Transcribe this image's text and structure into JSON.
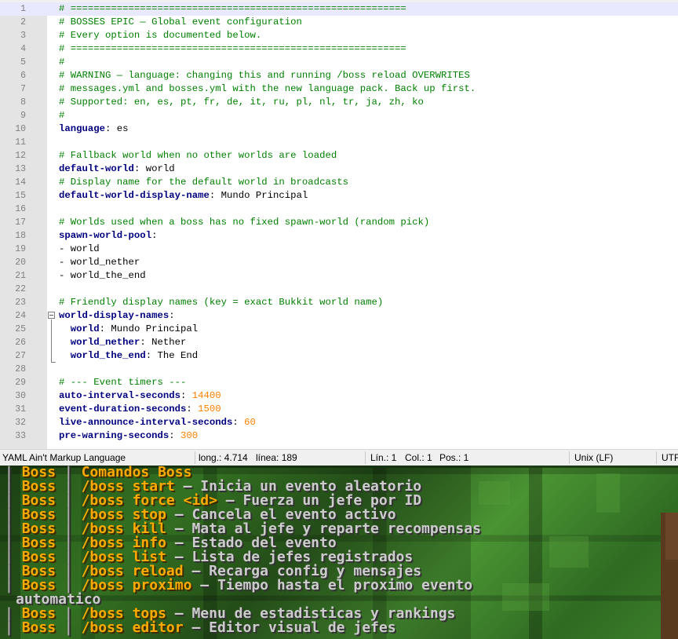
{
  "editor": {
    "current_line": 1,
    "fold_line": 24,
    "lines": [
      {
        "n": "1",
        "segs": [
          {
            "t": "# ==========================================================",
            "c": "cm"
          }
        ]
      },
      {
        "n": "2",
        "segs": [
          {
            "t": "# BOSSES EPIC — Global event configuration",
            "c": "cm"
          }
        ]
      },
      {
        "n": "3",
        "segs": [
          {
            "t": "# Every option is documented below.",
            "c": "cm"
          }
        ]
      },
      {
        "n": "4",
        "segs": [
          {
            "t": "# ==========================================================",
            "c": "cm"
          }
        ]
      },
      {
        "n": "5",
        "segs": [
          {
            "t": "#",
            "c": "cm"
          }
        ]
      },
      {
        "n": "6",
        "segs": [
          {
            "t": "# WARNING — language: changing this and running /boss reload OVERWRITES",
            "c": "cm"
          }
        ]
      },
      {
        "n": "7",
        "segs": [
          {
            "t": "# messages.yml and bosses.yml with the new language pack. Back up first.",
            "c": "cm"
          }
        ]
      },
      {
        "n": "8",
        "segs": [
          {
            "t": "# Supported: en, es, pt, fr, de, it, ru, pl, nl, tr, ja, zh, ko",
            "c": "cm"
          }
        ]
      },
      {
        "n": "9",
        "segs": [
          {
            "t": "#",
            "c": "cm"
          }
        ]
      },
      {
        "n": "10",
        "segs": [
          {
            "t": "language",
            "c": "key"
          },
          {
            "t": ": es",
            "c": "val"
          }
        ]
      },
      {
        "n": "11",
        "segs": []
      },
      {
        "n": "12",
        "segs": [
          {
            "t": "# Fallback world when no other worlds are loaded",
            "c": "cm"
          }
        ]
      },
      {
        "n": "13",
        "segs": [
          {
            "t": "default-world",
            "c": "key"
          },
          {
            "t": ": world",
            "c": "val"
          }
        ]
      },
      {
        "n": "14",
        "segs": [
          {
            "t": "# Display name for the default world in broadcasts",
            "c": "cm"
          }
        ]
      },
      {
        "n": "15",
        "segs": [
          {
            "t": "default-world-display-name",
            "c": "key"
          },
          {
            "t": ": Mundo Principal",
            "c": "val"
          }
        ]
      },
      {
        "n": "16",
        "segs": []
      },
      {
        "n": "17",
        "segs": [
          {
            "t": "# Worlds used when a boss has no fixed spawn-world (random pick)",
            "c": "cm"
          }
        ]
      },
      {
        "n": "18",
        "segs": [
          {
            "t": "spawn-world-pool",
            "c": "key"
          },
          {
            "t": ":",
            "c": "val"
          }
        ]
      },
      {
        "n": "19",
        "segs": [
          {
            "t": "- world",
            "c": "val"
          }
        ]
      },
      {
        "n": "20",
        "segs": [
          {
            "t": "- world_nether",
            "c": "val"
          }
        ]
      },
      {
        "n": "21",
        "segs": [
          {
            "t": "- world_the_end",
            "c": "val"
          }
        ]
      },
      {
        "n": "22",
        "segs": []
      },
      {
        "n": "23",
        "segs": [
          {
            "t": "# Friendly display names (key = exact Bukkit world name)",
            "c": "cm"
          }
        ]
      },
      {
        "n": "24",
        "segs": [
          {
            "t": "world-display-names",
            "c": "key"
          },
          {
            "t": ":",
            "c": "val"
          }
        ]
      },
      {
        "n": "25",
        "segs": [
          {
            "t": "  ",
            "c": "val"
          },
          {
            "t": "world",
            "c": "key"
          },
          {
            "t": ": Mundo Principal",
            "c": "val"
          }
        ]
      },
      {
        "n": "26",
        "segs": [
          {
            "t": "  ",
            "c": "val"
          },
          {
            "t": "world_nether",
            "c": "key"
          },
          {
            "t": ": Nether",
            "c": "val"
          }
        ]
      },
      {
        "n": "27",
        "segs": [
          {
            "t": "  ",
            "c": "val"
          },
          {
            "t": "world_the_end",
            "c": "key"
          },
          {
            "t": ": The End",
            "c": "val"
          }
        ]
      },
      {
        "n": "28",
        "segs": []
      },
      {
        "n": "29",
        "segs": [
          {
            "t": "# --- Event timers ---",
            "c": "cm"
          }
        ]
      },
      {
        "n": "30",
        "segs": [
          {
            "t": "auto-interval-seconds",
            "c": "key"
          },
          {
            "t": ": ",
            "c": "val"
          },
          {
            "t": "14400",
            "c": "num"
          }
        ]
      },
      {
        "n": "31",
        "segs": [
          {
            "t": "event-duration-seconds",
            "c": "key"
          },
          {
            "t": ": ",
            "c": "val"
          },
          {
            "t": "1500",
            "c": "num"
          }
        ]
      },
      {
        "n": "32",
        "segs": [
          {
            "t": "live-announce-interval-seconds",
            "c": "key"
          },
          {
            "t": ": ",
            "c": "val"
          },
          {
            "t": "60",
            "c": "num"
          }
        ]
      },
      {
        "n": "33",
        "segs": [
          {
            "t": "pre-warning-seconds",
            "c": "key"
          },
          {
            "t": ": ",
            "c": "val"
          },
          {
            "t": "300",
            "c": "num"
          }
        ]
      }
    ]
  },
  "statusbar": {
    "language": "YAML Ain't Markup Language",
    "length": "long.: 4.714",
    "lines": "línea: 189",
    "ln": "Lín.: 1",
    "col": "Col.: 1",
    "pos": "Pos.: 1",
    "eol": "Unix (LF)",
    "encoding": "UTF"
  },
  "chat": {
    "lines": [
      {
        "segs": [
          {
            "t": "| ",
            "c": "bar"
          },
          {
            "t": "Boss",
            "c": "tag"
          },
          {
            "t": " | ",
            "c": "bar"
          },
          {
            "t": "Comandos Boss",
            "c": "tag"
          }
        ]
      },
      {
        "segs": [
          {
            "t": "| ",
            "c": "bar"
          },
          {
            "t": "Boss",
            "c": "tag"
          },
          {
            "t": " | ",
            "c": "bar"
          },
          {
            "t": "/boss start",
            "c": "cmd"
          },
          {
            "t": " — ",
            "c": "dash"
          },
          {
            "t": "Inicia un evento aleatorio",
            "c": "desc"
          }
        ]
      },
      {
        "segs": [
          {
            "t": "| ",
            "c": "bar"
          },
          {
            "t": "Boss",
            "c": "tag"
          },
          {
            "t": " | ",
            "c": "bar"
          },
          {
            "t": "/boss force <id>",
            "c": "cmd"
          },
          {
            "t": " — ",
            "c": "dash"
          },
          {
            "t": "Fuerza un jefe por ID",
            "c": "desc"
          }
        ]
      },
      {
        "segs": [
          {
            "t": "| ",
            "c": "bar"
          },
          {
            "t": "Boss",
            "c": "tag"
          },
          {
            "t": " | ",
            "c": "bar"
          },
          {
            "t": "/boss stop",
            "c": "cmd"
          },
          {
            "t": " — ",
            "c": "dash"
          },
          {
            "t": "Cancela el evento activo",
            "c": "desc"
          }
        ]
      },
      {
        "segs": [
          {
            "t": "| ",
            "c": "bar"
          },
          {
            "t": "Boss",
            "c": "tag"
          },
          {
            "t": " | ",
            "c": "bar"
          },
          {
            "t": "/boss kill",
            "c": "cmd"
          },
          {
            "t": " — ",
            "c": "dash"
          },
          {
            "t": "Mata al jefe y reparte recompensas",
            "c": "desc"
          }
        ]
      },
      {
        "segs": [
          {
            "t": "| ",
            "c": "bar"
          },
          {
            "t": "Boss",
            "c": "tag"
          },
          {
            "t": " | ",
            "c": "bar"
          },
          {
            "t": "/boss info",
            "c": "cmd"
          },
          {
            "t": " — ",
            "c": "dash"
          },
          {
            "t": "Estado del evento",
            "c": "desc"
          }
        ]
      },
      {
        "segs": [
          {
            "t": "| ",
            "c": "bar"
          },
          {
            "t": "Boss",
            "c": "tag"
          },
          {
            "t": " | ",
            "c": "bar"
          },
          {
            "t": "/boss list",
            "c": "cmd"
          },
          {
            "t": " — ",
            "c": "dash"
          },
          {
            "t": "Lista de jefes registrados",
            "c": "desc"
          }
        ]
      },
      {
        "segs": [
          {
            "t": "| ",
            "c": "bar"
          },
          {
            "t": "Boss",
            "c": "tag"
          },
          {
            "t": " | ",
            "c": "bar"
          },
          {
            "t": "/boss reload",
            "c": "cmd"
          },
          {
            "t": " — ",
            "c": "dash"
          },
          {
            "t": "Recarga config y mensajes",
            "c": "desc"
          }
        ]
      },
      {
        "segs": [
          {
            "t": "| ",
            "c": "bar"
          },
          {
            "t": "Boss",
            "c": "tag"
          },
          {
            "t": " | ",
            "c": "bar"
          },
          {
            "t": "/boss proximo",
            "c": "cmd"
          },
          {
            "t": " — ",
            "c": "dash"
          },
          {
            "t": "Tiempo hasta el proximo evento",
            "c": "desc"
          }
        ]
      },
      {
        "segs": [
          {
            "t": "automatico",
            "c": "wrap"
          }
        ]
      },
      {
        "segs": [
          {
            "t": "| ",
            "c": "bar"
          },
          {
            "t": "Boss",
            "c": "tag"
          },
          {
            "t": " | ",
            "c": "bar"
          },
          {
            "t": "/boss tops",
            "c": "cmd"
          },
          {
            "t": " — ",
            "c": "dash"
          },
          {
            "t": "Menu de estadisticas y rankings",
            "c": "desc"
          }
        ]
      },
      {
        "segs": [
          {
            "t": "| ",
            "c": "bar"
          },
          {
            "t": "Boss",
            "c": "tag"
          },
          {
            "t": " | ",
            "c": "bar"
          },
          {
            "t": "/boss editor",
            "c": "cmd"
          },
          {
            "t": " — ",
            "c": "dash"
          },
          {
            "t": "Editor visual de jefes",
            "c": "desc"
          }
        ]
      }
    ]
  }
}
